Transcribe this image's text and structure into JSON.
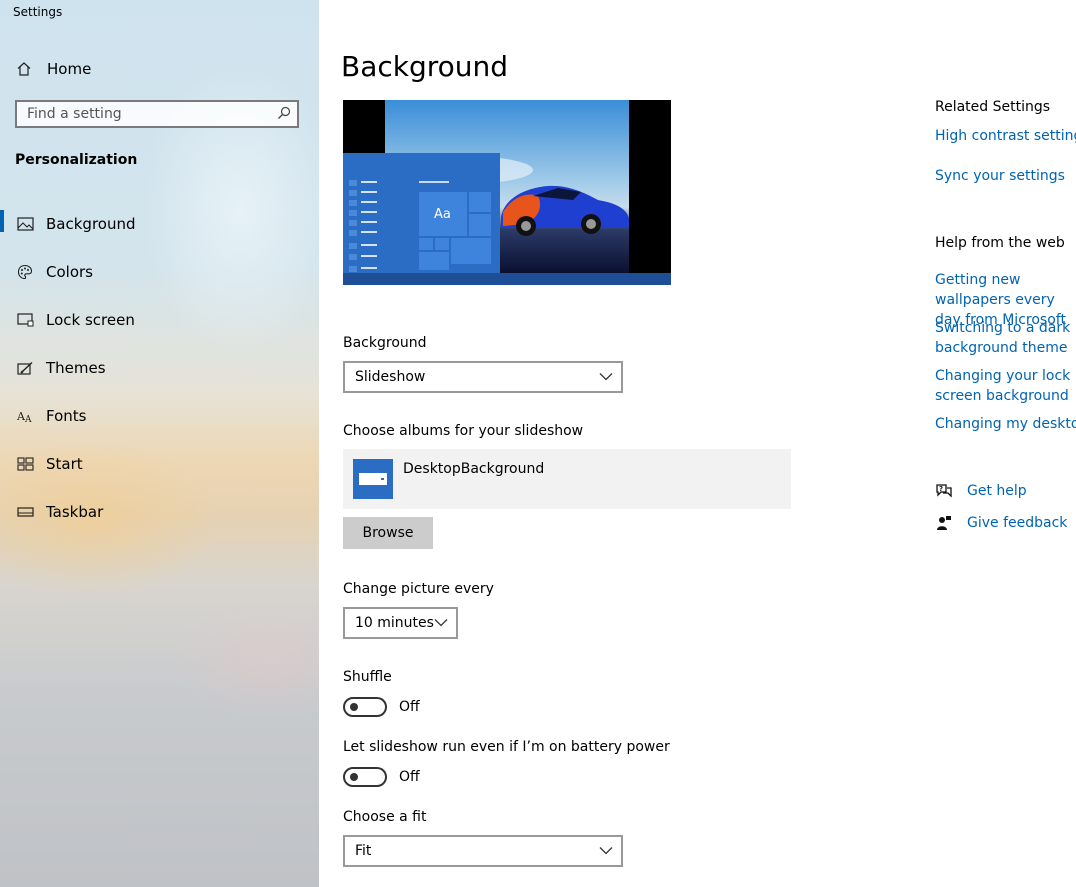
{
  "window": {
    "title": "Settings"
  },
  "sidebar": {
    "home_label": "Home",
    "search_placeholder": "Find a setting",
    "section_title": "Personalization",
    "items": [
      {
        "label": "Background",
        "icon": "image-icon",
        "active": true
      },
      {
        "label": "Colors",
        "icon": "palette-icon",
        "active": false
      },
      {
        "label": "Lock screen",
        "icon": "lock-screen-icon",
        "active": false
      },
      {
        "label": "Themes",
        "icon": "themes-icon",
        "active": false
      },
      {
        "label": "Fonts",
        "icon": "fonts-icon",
        "active": false
      },
      {
        "label": "Start",
        "icon": "start-icon",
        "active": false
      },
      {
        "label": "Taskbar",
        "icon": "taskbar-icon",
        "active": false
      }
    ]
  },
  "main": {
    "title": "Background",
    "preview": {
      "sample_text": "Aa"
    },
    "background_label": "Background",
    "background_value": "Slideshow",
    "albums_label": "Choose albums for your slideshow",
    "album_name": "DesktopBackground",
    "browse_label": "Browse",
    "interval_label": "Change picture every",
    "interval_value": "10 minutes",
    "shuffle_label": "Shuffle",
    "shuffle_state": "Off",
    "battery_label": "Let slideshow run even if I’m on battery power",
    "battery_state": "Off",
    "fit_label": "Choose a fit",
    "fit_value": "Fit"
  },
  "right": {
    "related_title": "Related Settings",
    "related_links": [
      "High contrast settings",
      "Sync your settings"
    ],
    "help_title": "Help from the web",
    "help_links": [
      "Getting new wallpapers every day from Microsoft",
      "Switching to a dark background theme",
      "Changing your lock screen background",
      "Changing my desktop background"
    ],
    "get_help": "Get help",
    "give_feedback": "Give feedback"
  },
  "colors": {
    "accent": "#0063b1",
    "preview_blue": "#2b6cc4"
  }
}
